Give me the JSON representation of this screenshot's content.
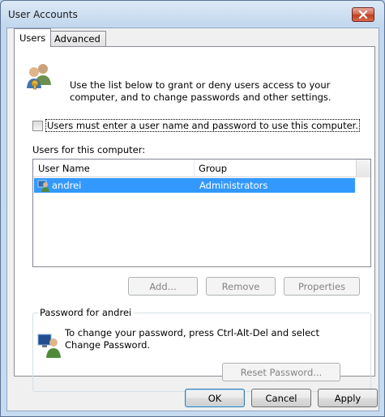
{
  "window": {
    "title": "User Accounts"
  },
  "tabs": [
    {
      "label": "Users",
      "active": true
    },
    {
      "label": "Advanced",
      "active": false
    }
  ],
  "intro": {
    "text": "Use the list below to grant or deny users access to your computer, and to change passwords and other settings."
  },
  "require_login": {
    "label": "Users must enter a user name and password to use this computer.",
    "checked": false
  },
  "users_list": {
    "label": "Users for this computer:",
    "columns": [
      "User Name",
      "Group"
    ],
    "rows": [
      {
        "user_name": "andrei",
        "group": "Administrators",
        "selected": true
      }
    ]
  },
  "list_buttons": {
    "add": "Add...",
    "remove": "Remove",
    "properties": "Properties"
  },
  "password_group": {
    "title": "Password for andrei",
    "text": "To change your password, press Ctrl-Alt-Del and select Change Password.",
    "reset_button": "Reset Password..."
  },
  "dialog_buttons": {
    "ok": "OK",
    "cancel": "Cancel",
    "apply": "Apply"
  },
  "icons": {
    "users": "users-icon",
    "user_small": "user-icon",
    "password_user": "password-user-icon",
    "close": "close-icon"
  },
  "colors": {
    "selection": "#3399ff",
    "close_red": "#c03f22"
  }
}
